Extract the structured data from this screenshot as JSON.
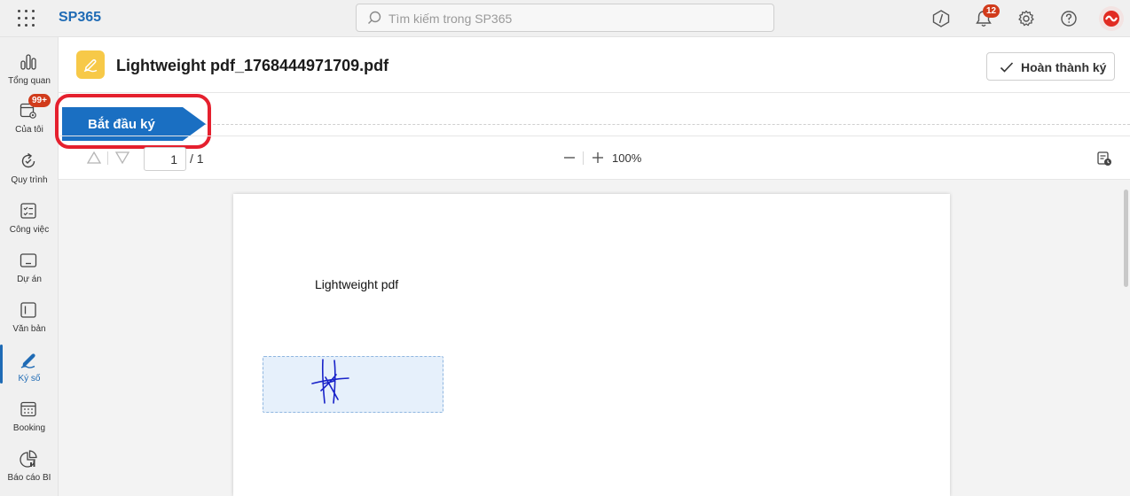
{
  "app": {
    "brand": "SP365",
    "search_placeholder": "Tìm kiếm trong SP365",
    "notification_count": "12"
  },
  "sidebar": {
    "items": [
      {
        "label": "Tổng quan",
        "icon": "chart-bar-icon"
      },
      {
        "label": "Của tôi",
        "icon": "calendar-mention-icon",
        "badge": "99+"
      },
      {
        "label": "Quy trình",
        "icon": "process-cycle-icon"
      },
      {
        "label": "Công việc",
        "icon": "task-list-icon"
      },
      {
        "label": "Dự án",
        "icon": "project-icon"
      },
      {
        "label": "Văn bản",
        "icon": "document-icon"
      },
      {
        "label": "Ký số",
        "icon": "digital-sign-icon",
        "active": true
      },
      {
        "label": "Booking",
        "icon": "booking-calendar-icon"
      },
      {
        "label": "Báo cáo BI",
        "icon": "bi-report-icon"
      }
    ]
  },
  "header": {
    "title": "Lightweight pdf_1768444971709.pdf",
    "complete_label": "Hoàn thành ký"
  },
  "step": {
    "label": "Bắt đầu ký"
  },
  "toolbar": {
    "page_current": "1",
    "page_total": "/ 1",
    "zoom": "100%"
  },
  "document": {
    "text": "Lightweight pdf"
  },
  "colors": {
    "accent": "#1f6bb5",
    "step_fill": "#1a6fc2",
    "highlight": "#e5202e",
    "badge": "#d13b1b",
    "signature_ink": "#1822c9"
  }
}
